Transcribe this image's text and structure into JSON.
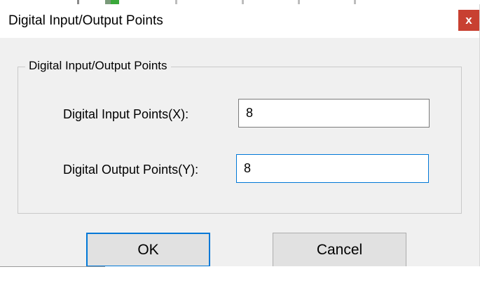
{
  "window": {
    "title": "Digital Input/Output Points",
    "close_glyph": "x"
  },
  "group": {
    "legend": "Digital Input/Output Points"
  },
  "fields": {
    "input_points": {
      "label": "Digital Input Points(X):",
      "value": "8"
    },
    "output_points": {
      "label": "Digital Output Points(Y):",
      "value": "8"
    }
  },
  "buttons": {
    "ok_label": "OK",
    "cancel_label": "Cancel"
  },
  "icons": {
    "close": "close-icon"
  },
  "colors": {
    "close_button": "#c84031",
    "focus_accent": "#0078d7",
    "dialog_background": "#f0f0f0",
    "button_face": "#e1e1e1"
  }
}
